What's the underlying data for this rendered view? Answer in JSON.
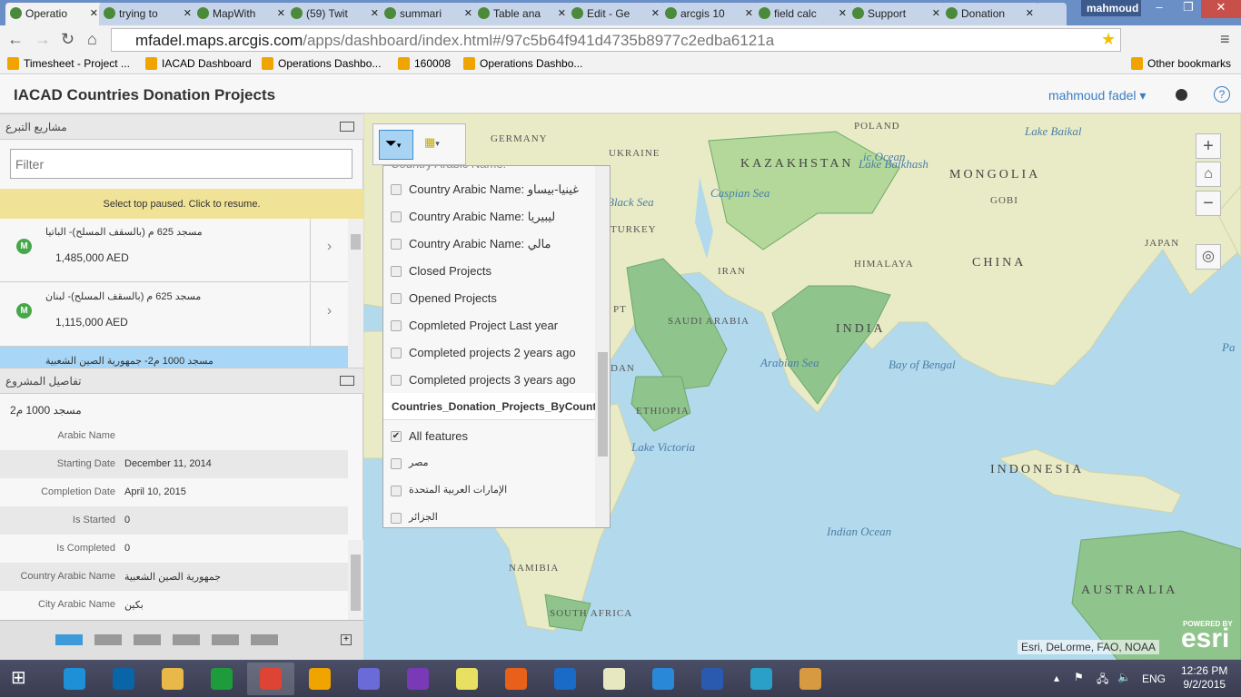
{
  "browser": {
    "tabs": [
      {
        "label": "Operatio",
        "active": true
      },
      {
        "label": "trying to"
      },
      {
        "label": "MapWith"
      },
      {
        "label": "(59) Twit"
      },
      {
        "label": "summari"
      },
      {
        "label": "Table ana"
      },
      {
        "label": "Edit - Ge"
      },
      {
        "label": "arcgis 10"
      },
      {
        "label": "field calc"
      },
      {
        "label": "Support"
      },
      {
        "label": "Donation"
      }
    ],
    "profile": "mahmoud",
    "url_host": "mfadel.maps.arcgis.com",
    "url_path": "/apps/dashboard/index.html#/97c5b64f941d4735b8977c2edba6121a",
    "bookmarks": [
      "Timesheet - Project ...",
      "IACAD Dashboard",
      "Operations Dashbo...",
      "160008",
      "Operations Dashbo..."
    ],
    "other_bookmarks": "Other bookmarks"
  },
  "app": {
    "title": "IACAD Countries Donation Projects",
    "user": "mahmoud fadel ▾",
    "help": "?"
  },
  "list_panel": {
    "title": "مشاريع التبرع",
    "filter_placeholder": "Filter",
    "paused_msg": "Select top paused. Click to resume.",
    "items": [
      {
        "title": "مسجد 625 م (بالسقف المسلح)- الباتيا",
        "value": "1,485,000 AED",
        "pin": "M"
      },
      {
        "title": "مسجد 625 م (بالسقف المسلح)- لبنان",
        "value": "1,115,000 AED",
        "pin": "M"
      },
      {
        "title": "مسجد 1000 م2- جمهورية الصين الشعبية",
        "selected": true
      }
    ]
  },
  "details_panel": {
    "title": "تفاصيل المشروع",
    "name": "مسجد 1000 م2",
    "rows": [
      {
        "k": "Arabic Name",
        "v": ""
      },
      {
        "k": "Starting Date",
        "v": "December 11, 2014"
      },
      {
        "k": "Completion Date",
        "v": "April 10, 2015"
      },
      {
        "k": "Is Started",
        "v": "0"
      },
      {
        "k": "Is Completed",
        "v": "0"
      },
      {
        "k": "Country Arabic Name",
        "v": "جمهورية الصين الشعبية"
      },
      {
        "k": "City Arabic Name",
        "v": "بكين"
      }
    ],
    "pages": 6,
    "active_page": 1
  },
  "filter_dropdown": {
    "partial_top": "Country Arabic Name:",
    "items": [
      "Country Arabic Name: غينيا-بيساو",
      "Country Arabic Name: ليبيريا",
      "Country Arabic Name: مالي",
      "Closed Projects",
      "Opened Projects",
      "Copmleted Project Last year",
      "Completed projects 2 years ago",
      "Completed projects 3 years ago"
    ],
    "section": "Countries_Donation_Projects_ByCountry",
    "section_items": [
      {
        "label": "All features",
        "checked": true
      },
      {
        "label": "مصر"
      },
      {
        "label": "الإمارات العربية المتحدة"
      },
      {
        "label": "الجزائر"
      }
    ]
  },
  "map": {
    "labels": [
      {
        "t": "POLAND",
        "c": ""
      },
      {
        "t": "GERMANY",
        "c": ""
      },
      {
        "t": "UKRAINE",
        "c": ""
      },
      {
        "t": "KAZAKHSTAN",
        "c": "big"
      },
      {
        "t": "MONGOLIA",
        "c": "big"
      },
      {
        "t": "TURKEY",
        "c": ""
      },
      {
        "t": "IRAN",
        "c": ""
      },
      {
        "t": "SAUDI ARABIA",
        "c": ""
      },
      {
        "t": "INDIA",
        "c": "big"
      },
      {
        "t": "CHINA",
        "c": "big"
      },
      {
        "t": "JAPAN",
        "c": ""
      },
      {
        "t": "ETHIOPIA",
        "c": ""
      },
      {
        "t": "INDONESIA",
        "c": "big"
      },
      {
        "t": "AUSTRALIA",
        "c": "big"
      },
      {
        "t": "NAMIBIA",
        "c": ""
      },
      {
        "t": "SOUTH AFRICA",
        "c": ""
      },
      {
        "t": "Arabian Sea",
        "c": "sea"
      },
      {
        "t": "Bay of Bengal",
        "c": "sea"
      },
      {
        "t": "Indian Ocean",
        "c": "sea"
      },
      {
        "t": "Black Sea",
        "c": "sea"
      },
      {
        "t": "Caspian Sea",
        "c": "sea"
      },
      {
        "t": "ic Ocean",
        "c": "sea"
      },
      {
        "t": "Pa",
        "c": "sea"
      },
      {
        "t": "Lake Balkhash",
        "c": "sea"
      },
      {
        "t": "Lake Baikal",
        "c": "sea"
      },
      {
        "t": "GOBI",
        "c": ""
      },
      {
        "t": "HIMALAYA",
        "c": ""
      },
      {
        "t": "Lake Victoria",
        "c": "sea"
      },
      {
        "t": "PT",
        "c": ""
      },
      {
        "t": "DAN",
        "c": ""
      }
    ],
    "attribution": "Esri, DeLorme, FAO, NOAA",
    "esri_powered": "POWERED BY",
    "esri_logo": "esri",
    "colors": {
      "sea": "#b3d9ec",
      "land": "#e9ebc6",
      "donation": "#8fc48c"
    }
  },
  "taskbar": {
    "lang": "ENG",
    "time": "12:26 PM",
    "date": "9/2/2015",
    "apps": [
      "ie",
      "outlook",
      "explorer",
      "store",
      "chrome",
      "ops-dashboard",
      "vs-infinity",
      "visual-studio",
      "arcmap",
      "firefox",
      "lync",
      "notepad",
      "arcgis-globe",
      "word",
      "search",
      "paint"
    ]
  }
}
